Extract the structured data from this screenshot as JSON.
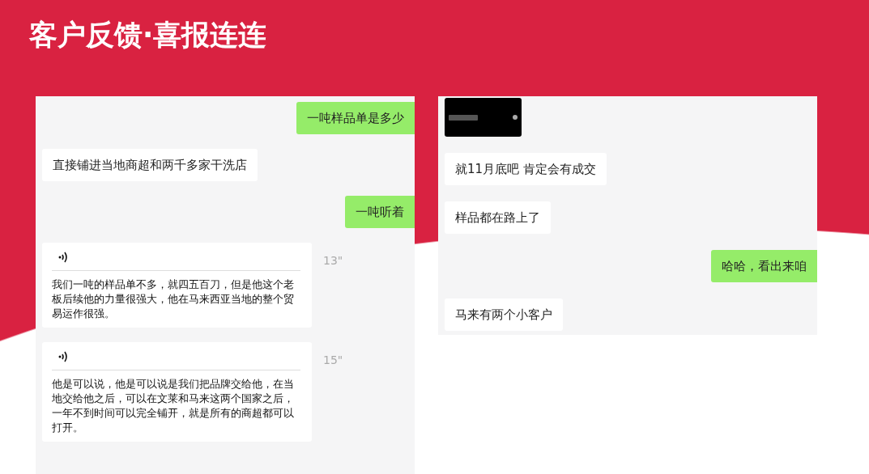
{
  "title": "客户反馈·喜报连连",
  "chats": [
    {
      "messages": [
        {
          "kind": "text",
          "outgoing": true,
          "text": "一吨样品单是多少"
        },
        {
          "kind": "text",
          "outgoing": false,
          "text": "直接铺进当地商超和两千多家干洗店"
        },
        {
          "kind": "text",
          "outgoing": true,
          "text": "一吨听着"
        },
        {
          "kind": "voice",
          "duration": "13\"",
          "transcript": "我们一吨的样品单不多，就四五百刀，但是他这个老板后续他的力量很强大，他在马来西亚当地的整个贸易运作很强。"
        },
        {
          "kind": "voice",
          "duration": "15\"",
          "transcript": "他是可以说，他是可以说是我们把品牌交给他，在当地交给他之后，可以在文莱和马来这两个国家之后，一年不到时间可以完全铺开，就是所有的商超都可以打开。"
        }
      ]
    },
    {
      "messages": [
        {
          "kind": "video"
        },
        {
          "kind": "text",
          "outgoing": false,
          "text": "就11月底吧 肯定会有成交"
        },
        {
          "kind": "text",
          "outgoing": false,
          "text": "样品都在路上了"
        },
        {
          "kind": "text",
          "outgoing": true,
          "text": "哈哈，看出来咱"
        },
        {
          "kind": "text",
          "outgoing": false,
          "text": "马来有两个小客户"
        }
      ]
    }
  ]
}
